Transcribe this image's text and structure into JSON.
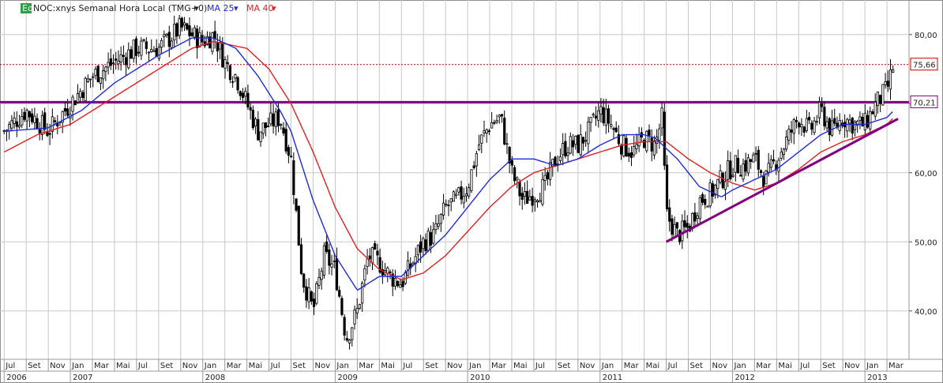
{
  "header": {
    "eq_badge": "Eq",
    "symbol_title": "NOC:xnys Semanal Hora Local (TMG+0)",
    "ma25_label": "MA 25",
    "ma40_label": "MA 40"
  },
  "price_tags": {
    "last_price": "75,66",
    "resistance_price": "70,21"
  },
  "colors": {
    "ma25": "#1f2bd8",
    "ma40": "#e02020",
    "candles": "#000000",
    "resistance_line": "#800080",
    "support_line": "#800080",
    "last_price_line": "#c00000",
    "grid": "#c8c8c8",
    "eq_badge": "#2e9e44"
  },
  "chart_data": {
    "type": "candlestick",
    "title": "NOC:xnys Semanal Hora Local (TMG+0)",
    "ylim": [
      33,
      85
    ],
    "y_ticks": [
      "40,00",
      "50,00",
      "60,00",
      "70,00",
      "80,00"
    ],
    "y_tick_values": [
      40,
      50,
      60,
      70,
      80
    ],
    "x_range": [
      "2006-07",
      "2013-04"
    ],
    "x_ticks": [
      {
        "t": "2006-07",
        "label": "Jul"
      },
      {
        "t": "2006-09",
        "label": "Set"
      },
      {
        "t": "2006-11",
        "label": "Nov"
      },
      {
        "t": "2007-01",
        "label": "Jan"
      },
      {
        "t": "2007-03",
        "label": "Mar"
      },
      {
        "t": "2007-05",
        "label": "Mai"
      },
      {
        "t": "2007-07",
        "label": "Jul"
      },
      {
        "t": "2007-09",
        "label": "Set"
      },
      {
        "t": "2007-11",
        "label": "Nov"
      },
      {
        "t": "2008-01",
        "label": "Jan"
      },
      {
        "t": "2008-03",
        "label": "Mar"
      },
      {
        "t": "2008-05",
        "label": "Mai"
      },
      {
        "t": "2008-07",
        "label": "Jul"
      },
      {
        "t": "2008-09",
        "label": "Set"
      },
      {
        "t": "2008-11",
        "label": "Nov"
      },
      {
        "t": "2009-01",
        "label": "Jan"
      },
      {
        "t": "2009-03",
        "label": "Mar"
      },
      {
        "t": "2009-05",
        "label": "Mai"
      },
      {
        "t": "2009-07",
        "label": "Jul"
      },
      {
        "t": "2009-09",
        "label": "Set"
      },
      {
        "t": "2009-11",
        "label": "Nov"
      },
      {
        "t": "2010-01",
        "label": "Jan"
      },
      {
        "t": "2010-03",
        "label": "Mar"
      },
      {
        "t": "2010-05",
        "label": "Mai"
      },
      {
        "t": "2010-07",
        "label": "Jul"
      },
      {
        "t": "2010-09",
        "label": "Set"
      },
      {
        "t": "2010-11",
        "label": "Nov"
      },
      {
        "t": "2011-01",
        "label": "Jan"
      },
      {
        "t": "2011-03",
        "label": "Mar"
      },
      {
        "t": "2011-05",
        "label": "Mai"
      },
      {
        "t": "2011-07",
        "label": "Jul"
      },
      {
        "t": "2011-09",
        "label": "Set"
      },
      {
        "t": "2011-11",
        "label": "Nov"
      },
      {
        "t": "2012-01",
        "label": "Jan"
      },
      {
        "t": "2012-03",
        "label": "Mar"
      },
      {
        "t": "2012-05",
        "label": "Mai"
      },
      {
        "t": "2012-07",
        "label": "Jul"
      },
      {
        "t": "2012-09",
        "label": "Set"
      },
      {
        "t": "2012-11",
        "label": "Nov"
      },
      {
        "t": "2013-01",
        "label": "Jan"
      },
      {
        "t": "2013-03",
        "label": "Mar"
      }
    ],
    "year_labels": [
      {
        "t": "2006-07",
        "label": "2006"
      },
      {
        "t": "2007-01",
        "label": "2007"
      },
      {
        "t": "2008-01",
        "label": "2008"
      },
      {
        "t": "2009-01",
        "label": "2009"
      },
      {
        "t": "2010-01",
        "label": "2010"
      },
      {
        "t": "2011-01",
        "label": "2011"
      },
      {
        "t": "2012-01",
        "label": "2012"
      },
      {
        "t": "2013-01",
        "label": "2013"
      }
    ],
    "close_anchors": [
      {
        "t": "2006-07",
        "v": 66
      },
      {
        "t": "2006-09",
        "v": 69
      },
      {
        "t": "2006-11",
        "v": 66
      },
      {
        "t": "2007-01",
        "v": 70
      },
      {
        "t": "2007-03",
        "v": 74
      },
      {
        "t": "2007-05",
        "v": 76
      },
      {
        "t": "2007-07",
        "v": 78
      },
      {
        "t": "2007-09",
        "v": 78
      },
      {
        "t": "2007-11",
        "v": 81
      },
      {
        "t": "2008-01",
        "v": 79
      },
      {
        "t": "2008-02",
        "v": 80
      },
      {
        "t": "2008-03",
        "v": 76
      },
      {
        "t": "2008-04",
        "v": 74
      },
      {
        "t": "2008-05",
        "v": 70
      },
      {
        "t": "2008-06",
        "v": 66
      },
      {
        "t": "2008-08",
        "v": 68
      },
      {
        "t": "2008-09",
        "v": 62
      },
      {
        "t": "2008-10",
        "v": 45
      },
      {
        "t": "2008-11",
        "v": 40
      },
      {
        "t": "2008-12",
        "v": 48
      },
      {
        "t": "2009-01",
        "v": 46
      },
      {
        "t": "2009-02",
        "v": 36
      },
      {
        "t": "2009-03",
        "v": 40
      },
      {
        "t": "2009-04",
        "v": 48
      },
      {
        "t": "2009-05",
        "v": 47
      },
      {
        "t": "2009-06",
        "v": 45
      },
      {
        "t": "2009-07",
        "v": 44
      },
      {
        "t": "2009-08",
        "v": 47
      },
      {
        "t": "2009-09",
        "v": 50
      },
      {
        "t": "2009-10",
        "v": 51
      },
      {
        "t": "2009-11",
        "v": 55
      },
      {
        "t": "2009-12",
        "v": 56
      },
      {
        "t": "2010-01",
        "v": 58
      },
      {
        "t": "2010-02",
        "v": 64
      },
      {
        "t": "2010-03",
        "v": 67
      },
      {
        "t": "2010-04",
        "v": 68
      },
      {
        "t": "2010-05",
        "v": 60
      },
      {
        "t": "2010-06",
        "v": 56
      },
      {
        "t": "2010-07",
        "v": 57
      },
      {
        "t": "2010-08",
        "v": 58
      },
      {
        "t": "2010-09",
        "v": 62
      },
      {
        "t": "2010-10",
        "v": 64
      },
      {
        "t": "2010-11",
        "v": 64
      },
      {
        "t": "2010-12",
        "v": 66
      },
      {
        "t": "2011-01",
        "v": 69
      },
      {
        "t": "2011-02",
        "v": 67
      },
      {
        "t": "2011-03",
        "v": 64
      },
      {
        "t": "2011-04",
        "v": 63
      },
      {
        "t": "2011-05",
        "v": 65
      },
      {
        "t": "2011-06",
        "v": 64
      },
      {
        "t": "2011-06-20",
        "v": 68
      },
      {
        "t": "2011-07",
        "v": 54
      },
      {
        "t": "2011-08",
        "v": 51
      },
      {
        "t": "2011-09",
        "v": 52
      },
      {
        "t": "2011-10",
        "v": 56
      },
      {
        "t": "2011-11",
        "v": 57
      },
      {
        "t": "2011-12",
        "v": 59
      },
      {
        "t": "2012-01",
        "v": 61
      },
      {
        "t": "2012-02",
        "v": 61
      },
      {
        "t": "2012-03",
        "v": 62
      },
      {
        "t": "2012-04",
        "v": 59
      },
      {
        "t": "2012-05",
        "v": 62
      },
      {
        "t": "2012-06",
        "v": 65
      },
      {
        "t": "2012-07",
        "v": 68
      },
      {
        "t": "2012-08",
        "v": 66
      },
      {
        "t": "2012-09",
        "v": 69
      },
      {
        "t": "2012-10",
        "v": 66
      },
      {
        "t": "2012-11",
        "v": 68
      },
      {
        "t": "2012-12",
        "v": 67
      },
      {
        "t": "2013-01",
        "v": 67
      },
      {
        "t": "2013-02",
        "v": 70
      },
      {
        "t": "2013-03",
        "v": 72
      },
      {
        "t": "2013-03-20",
        "v": 75.66
      }
    ],
    "ma25_anchors": [
      {
        "t": "2006-07",
        "v": 66
      },
      {
        "t": "2006-11",
        "v": 66.5
      },
      {
        "t": "2007-02",
        "v": 69
      },
      {
        "t": "2007-05",
        "v": 73
      },
      {
        "t": "2007-09",
        "v": 77
      },
      {
        "t": "2007-12",
        "v": 79.5
      },
      {
        "t": "2008-02",
        "v": 79.5
      },
      {
        "t": "2008-04",
        "v": 78
      },
      {
        "t": "2008-06",
        "v": 74
      },
      {
        "t": "2008-08",
        "v": 69
      },
      {
        "t": "2008-09",
        "v": 66
      },
      {
        "t": "2008-11",
        "v": 56
      },
      {
        "t": "2009-01",
        "v": 48
      },
      {
        "t": "2009-03",
        "v": 43
      },
      {
        "t": "2009-05",
        "v": 45
      },
      {
        "t": "2009-07",
        "v": 45
      },
      {
        "t": "2009-09",
        "v": 48
      },
      {
        "t": "2009-11",
        "v": 51
      },
      {
        "t": "2010-01",
        "v": 55
      },
      {
        "t": "2010-03",
        "v": 59
      },
      {
        "t": "2010-05",
        "v": 62
      },
      {
        "t": "2010-07",
        "v": 62
      },
      {
        "t": "2010-09",
        "v": 61
      },
      {
        "t": "2010-11",
        "v": 62
      },
      {
        "t": "2011-01",
        "v": 64
      },
      {
        "t": "2011-03",
        "v": 65.5
      },
      {
        "t": "2011-05",
        "v": 65.5
      },
      {
        "t": "2011-06",
        "v": 65
      },
      {
        "t": "2011-08",
        "v": 62
      },
      {
        "t": "2011-10",
        "v": 58
      },
      {
        "t": "2011-12",
        "v": 56.5
      },
      {
        "t": "2012-01",
        "v": 57.5
      },
      {
        "t": "2012-03",
        "v": 59
      },
      {
        "t": "2012-05",
        "v": 60.5
      },
      {
        "t": "2012-07",
        "v": 63
      },
      {
        "t": "2012-09",
        "v": 65.5
      },
      {
        "t": "2012-11",
        "v": 67
      },
      {
        "t": "2013-01",
        "v": 67
      },
      {
        "t": "2013-03",
        "v": 68
      },
      {
        "t": "2013-03-20",
        "v": 69
      }
    ],
    "ma40_anchors": [
      {
        "t": "2006-07",
        "v": 63
      },
      {
        "t": "2006-10",
        "v": 65.5
      },
      {
        "t": "2007-01",
        "v": 67
      },
      {
        "t": "2007-05",
        "v": 71
      },
      {
        "t": "2007-09",
        "v": 75
      },
      {
        "t": "2007-12",
        "v": 78
      },
      {
        "t": "2008-02",
        "v": 79
      },
      {
        "t": "2008-05",
        "v": 78
      },
      {
        "t": "2008-07",
        "v": 75
      },
      {
        "t": "2008-09",
        "v": 70
      },
      {
        "t": "2008-11",
        "v": 63
      },
      {
        "t": "2009-01",
        "v": 55
      },
      {
        "t": "2009-03",
        "v": 49
      },
      {
        "t": "2009-05",
        "v": 46
      },
      {
        "t": "2009-07",
        "v": 44.5
      },
      {
        "t": "2009-09",
        "v": 45.5
      },
      {
        "t": "2009-11",
        "v": 48
      },
      {
        "t": "2010-01",
        "v": 51.5
      },
      {
        "t": "2010-03",
        "v": 55
      },
      {
        "t": "2010-05",
        "v": 58
      },
      {
        "t": "2010-07",
        "v": 60
      },
      {
        "t": "2010-09",
        "v": 61
      },
      {
        "t": "2010-11",
        "v": 62
      },
      {
        "t": "2011-01",
        "v": 63
      },
      {
        "t": "2011-03",
        "v": 64
      },
      {
        "t": "2011-05",
        "v": 64.5
      },
      {
        "t": "2011-07",
        "v": 64.5
      },
      {
        "t": "2011-09",
        "v": 62
      },
      {
        "t": "2011-11",
        "v": 60
      },
      {
        "t": "2012-01",
        "v": 58.5
      },
      {
        "t": "2012-03",
        "v": 57.5
      },
      {
        "t": "2012-05",
        "v": 58.5
      },
      {
        "t": "2012-07",
        "v": 60.5
      },
      {
        "t": "2012-09",
        "v": 63
      },
      {
        "t": "2012-11",
        "v": 64.5
      },
      {
        "t": "2013-01",
        "v": 65.5
      },
      {
        "t": "2013-03",
        "v": 67
      },
      {
        "t": "2013-03-20",
        "v": 68
      }
    ],
    "last_price_level": 75.66,
    "resistance_level": 70.21,
    "support_trendline": [
      {
        "t": "2011-07",
        "v": 50
      },
      {
        "t": "2013-04",
        "v": 67.8
      }
    ]
  }
}
